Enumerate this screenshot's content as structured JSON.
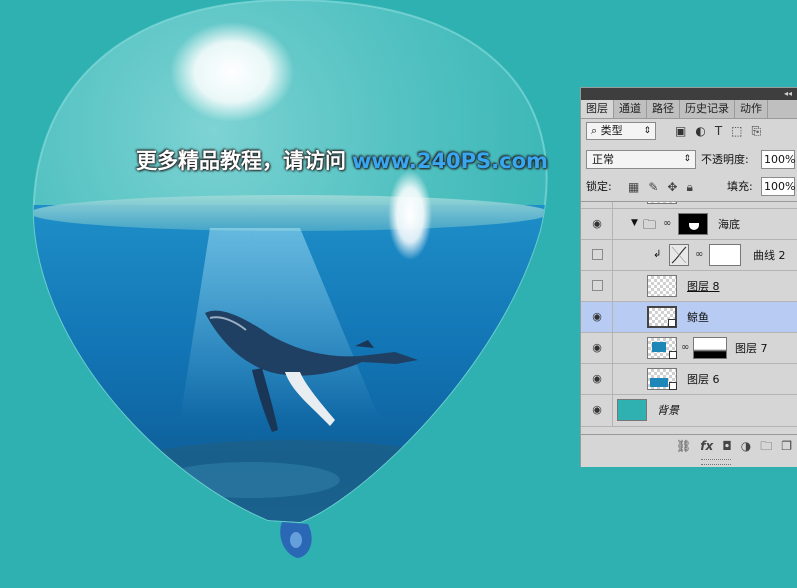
{
  "watermark": {
    "text": "更多精品教程，请访问",
    "site": "www.240PS.com"
  },
  "colors": {
    "background": "#2fb1b1",
    "panel": "#d6d6d6",
    "selected_row": "#b7cbf3",
    "background_swatch": "#2fb1b1"
  },
  "panel": {
    "tabs": [
      "图层",
      "通道",
      "路径",
      "历史记录",
      "动作"
    ],
    "active_tab": "图层",
    "filter_label": "类型",
    "filter_icons": [
      "image-filter-icon",
      "adjustment-filter-icon",
      "type-filter-icon",
      "shape-filter-icon",
      "smart-object-filter-icon"
    ],
    "blend_mode": "正常",
    "opacity_label": "不透明度:",
    "opacity_value": "100%",
    "lock_label": "锁定:",
    "fill_label": "填充:",
    "fill_value": "100%",
    "layers": [
      {
        "name": "海底",
        "type": "group",
        "visible": true
      },
      {
        "name": "曲线 2",
        "type": "adjustment",
        "visible": false
      },
      {
        "name": "图层 8",
        "type": "smart-object",
        "visible": false
      },
      {
        "name": "鲸鱼",
        "type": "smart-object",
        "visible": true,
        "selected": true
      },
      {
        "name": "图层 7",
        "type": "smart-object-masked",
        "visible": true
      },
      {
        "name": "图层 6",
        "type": "smart-object",
        "visible": true
      },
      {
        "name": "背景",
        "type": "background",
        "visible": true
      }
    ],
    "footer_icons": [
      "link-layers-icon",
      "fx-icon",
      "add-mask-icon",
      "new-adjustment-icon",
      "new-group-icon",
      "new-layer-icon"
    ],
    "fx_label": "fx"
  }
}
